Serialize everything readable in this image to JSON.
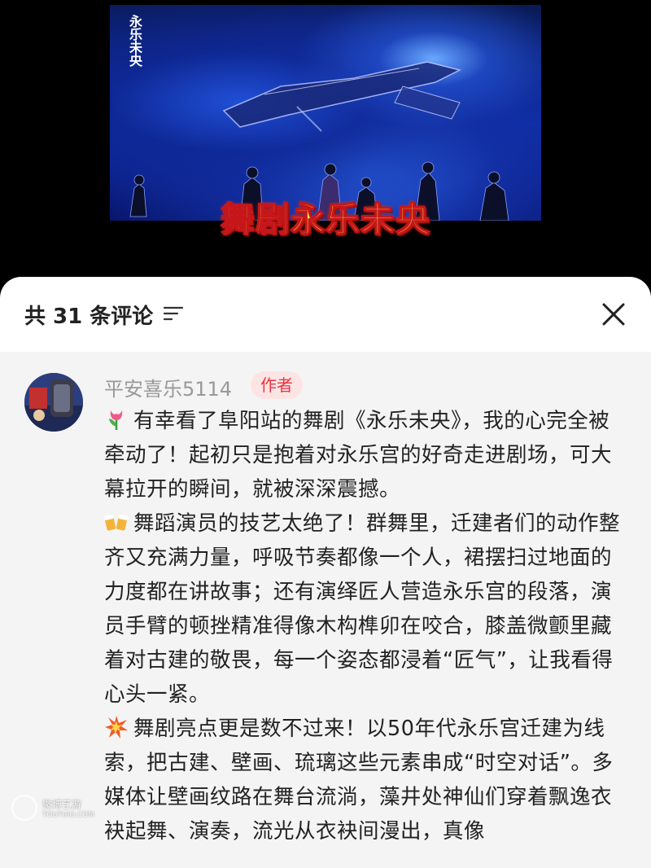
{
  "video": {
    "logo_text": "永乐未央",
    "caption": "舞剧永乐未央"
  },
  "sheet": {
    "title": "共 31 条评论",
    "sort_icon": "sort-filter-icon",
    "close_icon": "close-icon"
  },
  "comment": {
    "username": "平安喜乐5114",
    "badge": "作者",
    "paragraphs": [
      {
        "emoji": "tulip-emoji",
        "text": "有幸看了阜阳站的舞剧《永乐未央》，我的心完全被牵动了！起初只是抱着对永乐宫的好奇走进剧场，可大幕拉开的瞬间，就被深深震撼。"
      },
      {
        "emoji": "clinking-beer-mugs-emoji",
        "text": "舞蹈演员的技艺太绝了！群舞里，迁建者们的动作整齐又充满力量，呼吸节奏都像一个人，裙摆扫过地面的力度都在讲故事；还有演绎匠人营造永乐宫的段落，演员手臂的顿挫精准得像木构榫卯在咬合，膝盖微颤里藏着对古建的敬畏，每一个姿态都浸着“匠气”，让我看得心头一紧。"
      },
      {
        "emoji": "collision-emoji",
        "text": "舞剧亮点更是数不过来！以50年代永乐宫迁建为线索，把古建、壁画、琉璃这些元素串成“时空对话”。多媒体让壁画纹路在舞台流淌，藻井处神仙们穿着飘逸衣袂起舞、演奏，流光从衣袂间漫出，真像"
      }
    ]
  },
  "watermark": {
    "line1": "微博艺游",
    "line2": "TOUTIAO.COM"
  },
  "colors": {
    "accent_red": "#e8343f",
    "badge_bg": "#fde4e4",
    "caption_yellow": "#ffe14a"
  }
}
